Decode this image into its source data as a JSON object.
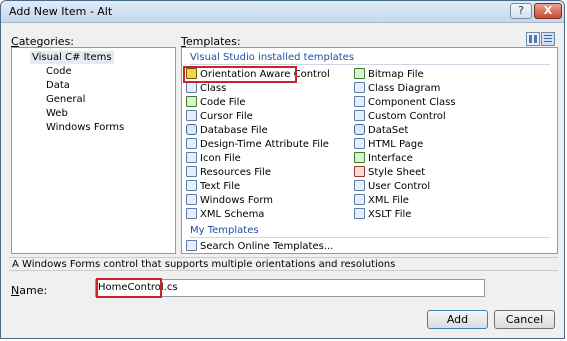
{
  "window": {
    "title": "Add New Item - Alt",
    "help_glyph": "?",
    "close_glyph": "X"
  },
  "categories": {
    "label_accel": "C",
    "label_rest": "ategories:",
    "items": [
      {
        "label": "Visual C# Items"
      },
      {
        "label": "Code"
      },
      {
        "label": "Data"
      },
      {
        "label": "General"
      },
      {
        "label": "Web"
      },
      {
        "label": "Windows Forms"
      }
    ]
  },
  "templates": {
    "label_accel": "T",
    "label_rest": "emplates:",
    "installed_header": "Visual Studio installed templates",
    "left": [
      {
        "label": "Orientation Aware Control",
        "icon": "orientation-aware-control-icon"
      },
      {
        "label": "Class",
        "icon": "class-icon"
      },
      {
        "label": "Code File",
        "icon": "code-file-icon"
      },
      {
        "label": "Cursor File",
        "icon": "cursor-file-icon"
      },
      {
        "label": "Database File",
        "icon": "database-file-icon"
      },
      {
        "label": "Design-Time Attribute File",
        "icon": "design-time-attribute-file-icon"
      },
      {
        "label": "Icon File",
        "icon": "icon-file-icon"
      },
      {
        "label": "Resources File",
        "icon": "resources-file-icon"
      },
      {
        "label": "Text File",
        "icon": "text-file-icon"
      },
      {
        "label": "Windows Form",
        "icon": "windows-form-icon"
      },
      {
        "label": "XML Schema",
        "icon": "xml-schema-icon"
      }
    ],
    "right": [
      {
        "label": "Bitmap File",
        "icon": "bitmap-file-icon"
      },
      {
        "label": "Class Diagram",
        "icon": "class-diagram-icon"
      },
      {
        "label": "Component Class",
        "icon": "component-class-icon"
      },
      {
        "label": "Custom Control",
        "icon": "custom-control-icon"
      },
      {
        "label": "DataSet",
        "icon": "dataset-icon"
      },
      {
        "label": "HTML Page",
        "icon": "html-page-icon"
      },
      {
        "label": "Interface",
        "icon": "interface-icon"
      },
      {
        "label": "Style Sheet",
        "icon": "style-sheet-icon"
      },
      {
        "label": "User Control",
        "icon": "user-control-icon"
      },
      {
        "label": "XML File",
        "icon": "xml-file-icon"
      },
      {
        "label": "XSLT File",
        "icon": "xslt-file-icon"
      }
    ],
    "my_header": "My Templates",
    "my_items": [
      {
        "label": "Search Online Templates...",
        "icon": "search-online-templates-icon"
      }
    ]
  },
  "description": "A Windows Forms control that supports multiple orientations and resolutions",
  "name_field": {
    "label_accel": "N",
    "label_rest": "ame:",
    "value": "HomeControl.cs"
  },
  "buttons": {
    "add": "Add",
    "cancel": "Cancel"
  },
  "colors": {
    "highlight_box": "#d0202a",
    "group_header": "#1f4fa5"
  }
}
